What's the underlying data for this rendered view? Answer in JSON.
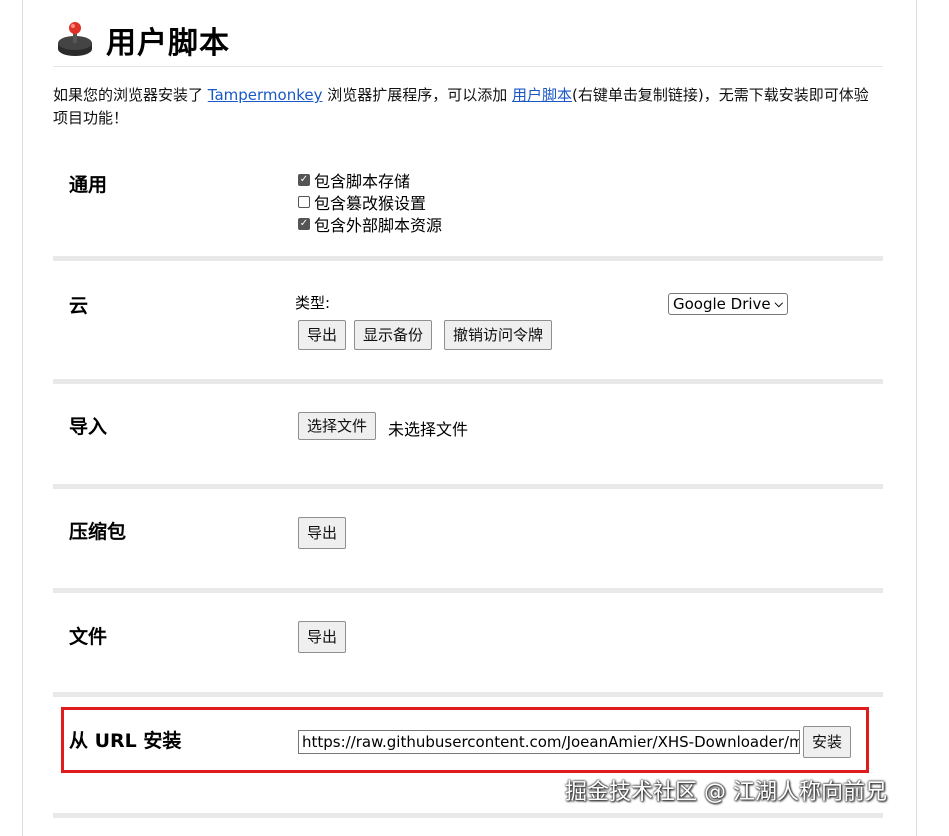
{
  "header": {
    "title": "用户脚本",
    "logo_icon": "joystick-icon"
  },
  "intro": {
    "text_before": "如果您的浏览器安装了 ",
    "link_tampermonkey": "Tampermonkey",
    "text_middle": " 浏览器扩展程序，可以添加 ",
    "link_userscript": "用户脚本",
    "text_after": "(右键单击复制链接)，无需下载安装即可体验项目功能！"
  },
  "general": {
    "label": "通用",
    "options": [
      {
        "label": "包含脚本存储",
        "checked": true
      },
      {
        "label": "包含篡改猴设置",
        "checked": false
      },
      {
        "label": "包含外部脚本资源",
        "checked": true
      }
    ]
  },
  "cloud": {
    "label": "云",
    "type_label": "类型:",
    "type_selected": "Google Drive",
    "export_label": "导出",
    "show_backup_label": "显示备份",
    "revoke_label": "撤销访问令牌"
  },
  "import": {
    "label": "导入",
    "choose_file_label": "选择文件",
    "no_file_text": "未选择文件"
  },
  "zip": {
    "label": "压缩包",
    "export_label": "导出"
  },
  "file": {
    "label": "文件",
    "export_label": "导出"
  },
  "url_install": {
    "label": "从 URL 安装",
    "url_value": "https://raw.githubusercontent.com/JoeanAmier/XHS-Downloader/master/static/XHS-Downloader.js",
    "install_label": "安装"
  },
  "watermark": "掘金技术社区 @ 江湖人称向前兄",
  "colors": {
    "highlight": "#e01b1b",
    "link": "#1a58c8",
    "separator": "#e9e9e9"
  }
}
